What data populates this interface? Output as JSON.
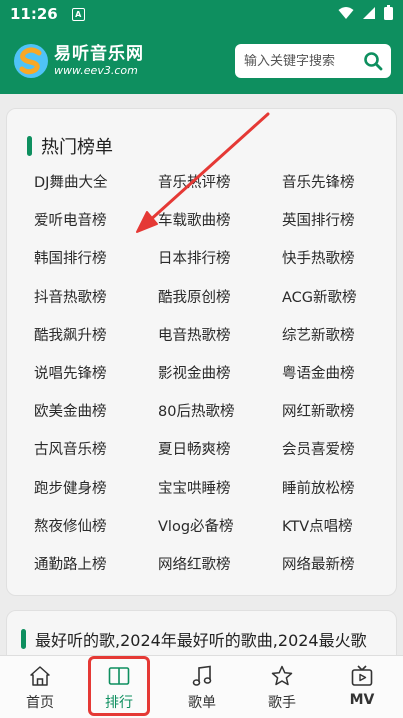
{
  "status": {
    "time": "11:26",
    "app_icon_letter": "A"
  },
  "header": {
    "logo_title": "易听音乐网",
    "logo_url": "www.eev3.com",
    "search_placeholder": "输入关键字搜索"
  },
  "hot_charts": {
    "title": "热门榜单",
    "items": [
      "DJ舞曲大全",
      "音乐热评榜",
      "音乐先锋榜",
      "爱听电音榜",
      "车载歌曲榜",
      "英国排行榜",
      "韩国排行榜",
      "日本排行榜",
      "快手热歌榜",
      "抖音热歌榜",
      "酷我原创榜",
      "ACG新歌榜",
      "酷我飙升榜",
      "电音热歌榜",
      "综艺新歌榜",
      "说唱先锋榜",
      "影视金曲榜",
      "粤语金曲榜",
      "欧美金曲榜",
      "80后热歌榜",
      "网红新歌榜",
      "古风音乐榜",
      "夏日畅爽榜",
      "会员喜爱榜",
      "跑步健身榜",
      "宝宝哄睡榜",
      "睡前放松榜",
      "熬夜修仙榜",
      "Vlog必备榜",
      "KTV点唱榜",
      "通勤路上榜",
      "网络红歌榜",
      "网络最新榜"
    ]
  },
  "second_section": {
    "title": "最好听的歌,2024年最好听的歌曲,2024最火歌"
  },
  "tabbar": {
    "tabs": [
      {
        "label": "首页",
        "icon": "home-icon"
      },
      {
        "label": "排行",
        "icon": "book-icon"
      },
      {
        "label": "歌单",
        "icon": "music-note-icon"
      },
      {
        "label": "歌手",
        "icon": "star-icon"
      },
      {
        "label": "MV",
        "icon": "tv-play-icon"
      }
    ],
    "active_index": 1
  },
  "colors": {
    "brand": "#0e8f5f",
    "highlight": "#e53935",
    "arrow": "#e53935"
  }
}
